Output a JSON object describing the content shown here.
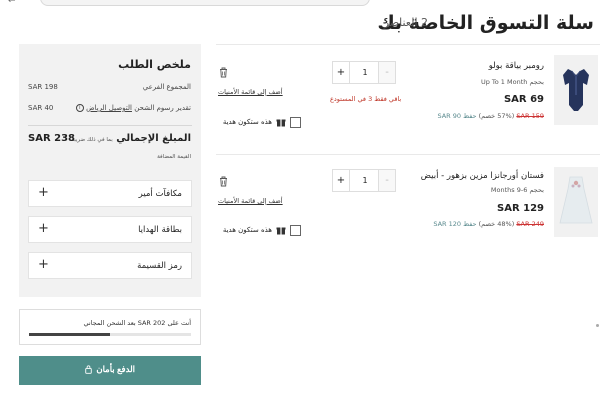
{
  "header": {
    "title": "سلة التسوق الخاصة بك",
    "items_count": "2 العناصر"
  },
  "summary": {
    "title": "ملخص الطلب",
    "subtotal_label": "المجموع الفرعي",
    "subtotal_value": "SAR 198",
    "shipping_label_prefix": "تقدير رسوم الشحن",
    "shipping_label_link": "التوصيل الرياض",
    "shipping_value": "SAR 40",
    "total_label": "المبلغ الإجمالي",
    "total_tax_note": "بما في ذلك ضريبة",
    "total_vat_note": "القيمة المضافة",
    "total_value": "SAR 238",
    "accordions": [
      {
        "label": "مكافآت أمير"
      },
      {
        "label": "بطاقة الهدايا"
      },
      {
        "label": "رمز القسيمة"
      }
    ],
    "plus_symbol": "+"
  },
  "free_shipping": {
    "text": "أنت على SAR 202 بعد الشحن المجاني",
    "progress": 0.5
  },
  "pay_button": {
    "label": "الدفع بأمان"
  },
  "products": [
    {
      "name": "رومبر بياقة بولو",
      "size_label": "بحجم",
      "size_value": "Up To 1 Month",
      "price": "SAR 69",
      "old_price": "SAR 159",
      "discount": "(57% خصم)",
      "save": "حفظ SAR 90",
      "quantity": "1",
      "stock_note": "باقي فقط 3 في المستودع",
      "wishlist": "أضف إلى قائمة الأمنيات",
      "gift_label": "هذه ستكون هدية"
    },
    {
      "name": "فستان أورجانزا مزين بزهور - أبيض",
      "size_label": "بحجم",
      "size_value": "6-9 Months",
      "price": "SAR 129",
      "old_price": "SAR 249",
      "discount": "(48% خصم)",
      "save": "حفظ SAR 120",
      "quantity": "1",
      "stock_note": "",
      "wishlist": "أضف إلى قائمة الأمنيات",
      "gift_label": "هذه ستكون هدية"
    }
  ],
  "qty_controls": {
    "plus": "+",
    "minus": "-"
  },
  "colors": {
    "accent": "#4f8e8a",
    "old_price": "#c33333",
    "stock_warning": "#c0392b",
    "summary_bg": "#f2f2f2"
  },
  "icons": [
    "trash-icon",
    "gift-icon",
    "lock-icon",
    "info-icon",
    "back-arrow-icon"
  ]
}
